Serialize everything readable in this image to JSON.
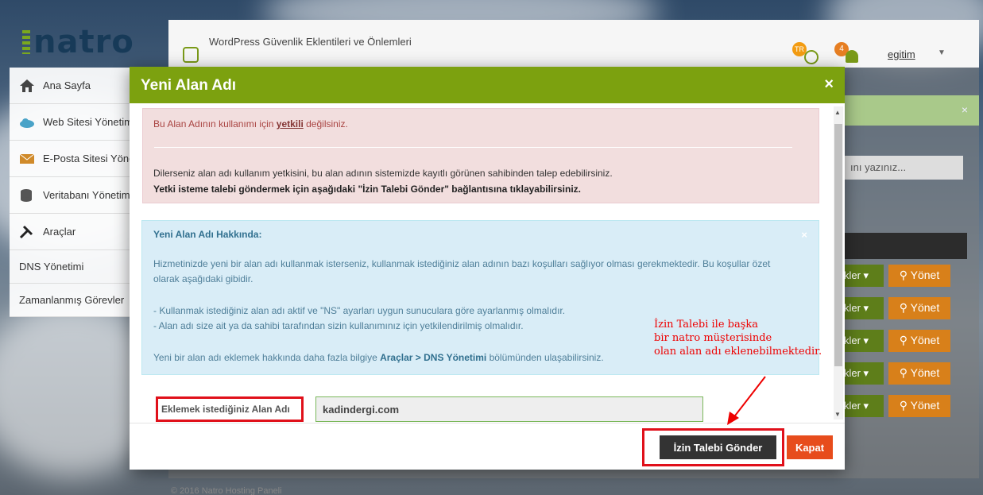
{
  "app": {
    "logo": "natro",
    "page_title": "WordPress Güvenlik Eklentileri ve Önlemleri",
    "lang_badge": "TR",
    "notif_count": "4",
    "username": "egitim",
    "footer": "© 2016 Natro Hosting Paneli"
  },
  "sidebar": {
    "items": [
      {
        "label": "Ana Sayfa"
      },
      {
        "label": "Web Sitesi Yönetimi"
      },
      {
        "label": "E-Posta Sitesi Yönetimi"
      },
      {
        "label": "Veritabanı Yönetimi"
      },
      {
        "label": "Araçlar"
      },
      {
        "label": "DNS Yönetimi"
      },
      {
        "label": "Zamanlanmış Görevler"
      }
    ]
  },
  "background": {
    "search_placeholder": "ını yazınız...",
    "row_actions": {
      "ekler": "kler ▾",
      "yonet": "Yönet"
    }
  },
  "modal": {
    "title": "Yeni Alan Adı",
    "close": "×",
    "danger": {
      "line1_pre": "Bu Alan Adının kullanımı için ",
      "line1_link": "yetkili",
      "line1_post": " değilsiniz.",
      "line2": "Dilerseniz alan adı kullanım yetkisini, bu alan adının sistemizde kayıtlı görünen sahibinden talep edebilirsiniz.",
      "line3": "Yetki isteme talebi göndermek için aşağıdaki \"İzin Talebi Gönder\" bağlantısına tıklayabilirsiniz."
    },
    "info": {
      "title": "Yeni Alan Adı Hakkında:",
      "close": "×",
      "p1": "Hizmetinizde yeni bir alan adı kullanmak isterseniz, kullanmak istediğiniz alan adının bazı koşulları sağlıyor olması gerekmektedir. Bu koşullar özet olarak aşağıdaki gibidir.",
      "bullet1": "- Kullanmak istediğiniz alan adı aktif ve \"NS\" ayarları uygun sunuculara göre ayarlanmış olmalıdır.",
      "bullet2": "- Alan adı size ait ya da sahibi tarafından sizin kullanımınız için yetkilendirilmiş olmalıdır.",
      "p3_pre": "Yeni bir alan adı eklemek hakkında daha fazla bilgiye ",
      "p3_bold": "Araçlar > DNS Yönetimi",
      "p3_post": " bölümünden ulaşabilirsiniz."
    },
    "form": {
      "label": "Eklemek istediğiniz Alan Adı",
      "value": "kadindergi.com"
    },
    "footer": {
      "send": "İzin Talebi Gönder",
      "close": "Kapat"
    }
  },
  "annotation": {
    "line1": "İzin Talebi ile başka",
    "line2": "bir natro müşterisinde",
    "line3": "olan alan adı eklenebilmektedir.",
    "color": "#ee0000"
  }
}
